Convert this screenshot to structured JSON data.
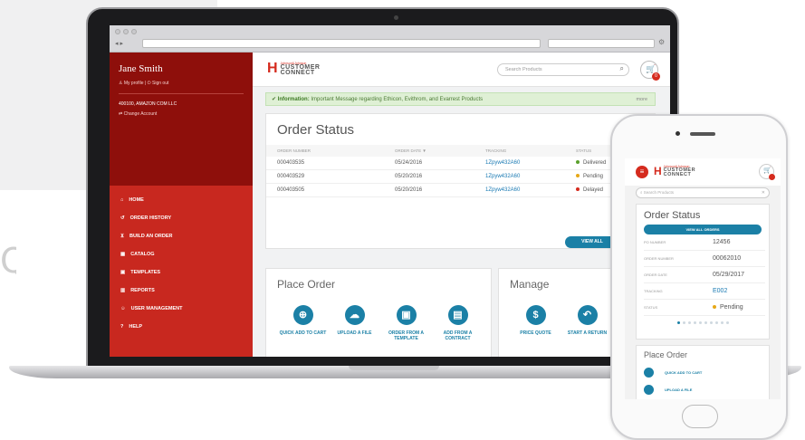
{
  "browser": {
    "url": "",
    "search": ""
  },
  "user": {
    "name": "Jane Smith",
    "my_profile": "My profile",
    "sign_out": "Sign out",
    "account": "400100, AMAZON COM LLC",
    "change_account": "Change Account"
  },
  "menu": [
    {
      "label": "HOME",
      "icon": "home-icon"
    },
    {
      "label": "ORDER HISTORY",
      "icon": "history-icon"
    },
    {
      "label": "BUILD AN ORDER",
      "icon": "cart-icon"
    },
    {
      "label": "CATALOG",
      "icon": "catalog-icon"
    },
    {
      "label": "TEMPLATES",
      "icon": "templates-icon"
    },
    {
      "label": "REPORTS",
      "icon": "reports-icon"
    },
    {
      "label": "USER MANAGEMENT",
      "icon": "users-icon"
    },
    {
      "label": "HELP",
      "icon": "help-icon"
    }
  ],
  "brand": {
    "small": "Johnson&Johnson",
    "line1": "CUSTOMER",
    "line2": "CONNECT"
  },
  "search": {
    "placeholder": "Search Products"
  },
  "cart": {
    "count": "0"
  },
  "info": {
    "label": "Information:",
    "text": "Important Message regarding Ethicon, Evithrom, and Evarrest Products",
    "more": "more"
  },
  "order_status": {
    "title": "Order Status",
    "headers": [
      "ORDER NUMBER",
      "ORDER DATE ▼",
      "TRACKING",
      "STATUS"
    ],
    "rows": [
      {
        "number": "000403535",
        "date": "05/24/2016",
        "tracking": "1Zpyw432A60",
        "status": "Delivered",
        "color": "#5aa02c"
      },
      {
        "number": "000403529",
        "date": "05/20/2016",
        "tracking": "1Zpyw432A60",
        "status": "Pending",
        "color": "#e6a817"
      },
      {
        "number": "000403505",
        "date": "05/20/2016",
        "tracking": "1Zpyw432A60",
        "status": "Delayed",
        "color": "#d52b1e"
      }
    ],
    "view_all": "VIEW ALL"
  },
  "place_order": {
    "title": "Place Order",
    "actions": [
      {
        "label": "QUICK ADD TO CART",
        "icon": "cart-icon",
        "glyph": "⊕"
      },
      {
        "label": "UPLOAD A FILE",
        "icon": "cloud-upload-icon",
        "glyph": "☁"
      },
      {
        "label": "ORDER FROM A TEMPLATE",
        "icon": "template-icon",
        "glyph": "▣"
      },
      {
        "label": "ADD FROM A CONTRACT",
        "icon": "contract-icon",
        "glyph": "▤"
      }
    ]
  },
  "manage": {
    "title": "Manage",
    "actions": [
      {
        "label": "PRICE QUOTE",
        "icon": "dollar-icon",
        "glyph": "$"
      },
      {
        "label": "START A RETURN",
        "icon": "return-icon",
        "glyph": "↶"
      }
    ]
  },
  "phone": {
    "search_placeholder": "Search Products",
    "order_status": {
      "title": "Order Status",
      "view_all": "VIEW ALL ORDERS",
      "rows": [
        {
          "label": "PO NUMBER",
          "value": "12456"
        },
        {
          "label": "ORDER NUMBER",
          "value": "00062010"
        },
        {
          "label": "ORDER DATE",
          "value": "05/29/2017"
        },
        {
          "label": "TRACKING",
          "value": "E002"
        },
        {
          "label": "STATUS",
          "value": "Pending"
        }
      ]
    },
    "place_order": {
      "title": "Place Order",
      "actions": [
        "QUICK ADD TO CART",
        "UPLOAD A FILE"
      ]
    }
  }
}
